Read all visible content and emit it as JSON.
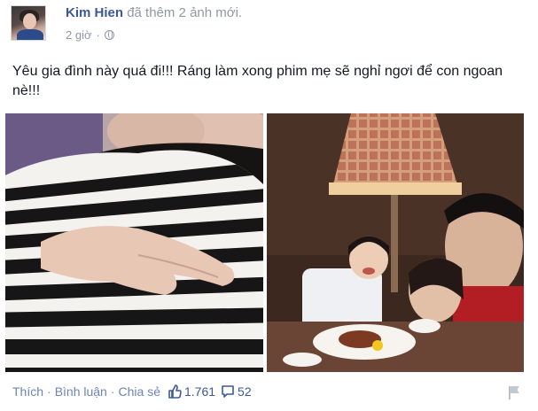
{
  "post": {
    "author": "Kim Hien",
    "action": "đã thêm 2 ảnh mới.",
    "time": "2 giờ",
    "separator": "·",
    "privacy_icon": "globe-icon",
    "text": "Yêu gia đình này quá đi!!! Ráng làm xong phim mẹ sẽ nghỉ ngơi để con ngoan nè!!!",
    "photos": [
      {
        "description_icon": "photo-pregnant-belly"
      },
      {
        "description_icon": "photo-family-dinner"
      }
    ]
  },
  "footer": {
    "like": "Thích",
    "comment": "Bình luận",
    "share": "Chia sẻ",
    "dot": "·",
    "likes_count": "1.761",
    "comments_count": "52"
  },
  "colors": {
    "link": "#3b5998",
    "muted": "#9197a3",
    "footer_link": "#6d84b4"
  }
}
